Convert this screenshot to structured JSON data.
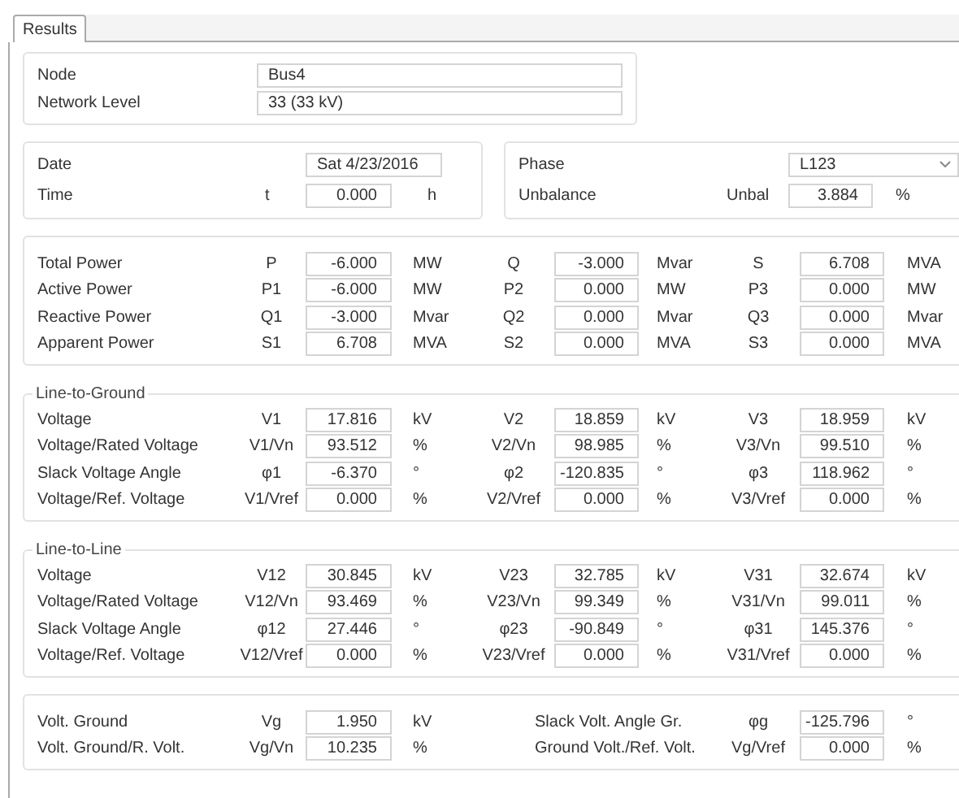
{
  "tabs": [
    {
      "label": "Results",
      "selected": true
    }
  ],
  "node": [
    {
      "label": "Node",
      "value": "Bus4"
    },
    {
      "label": "Network Level",
      "value": "33 (33 kV)"
    }
  ],
  "date_group": {
    "date": {
      "label": "Date",
      "value": "Sat 4/23/2016"
    },
    "time": {
      "label": "Time",
      "symbol": "t",
      "value": "0.000",
      "unit": "h"
    }
  },
  "phase_group": {
    "phase": {
      "label": "Phase",
      "value": "L123"
    },
    "unbalance": {
      "label": "Unbalance",
      "symbol": "Unbal",
      "value": "3.884",
      "unit": "%"
    }
  },
  "sections": [
    {
      "rows": [
        {
          "label": "Total Power",
          "cells": [
            {
              "symbol": "P",
              "value": "-6.000",
              "unit": "MW"
            },
            {
              "symbol": "Q",
              "value": "-3.000",
              "unit": "Mvar"
            },
            {
              "symbol": "S",
              "value": "6.708",
              "unit": "MVA"
            }
          ]
        },
        {
          "label": "Active Power",
          "cells": [
            {
              "symbol": "P1",
              "value": "-6.000",
              "unit": "MW"
            },
            {
              "symbol": "P2",
              "value": "0.000",
              "unit": "MW"
            },
            {
              "symbol": "P3",
              "value": "0.000",
              "unit": "MW"
            }
          ]
        },
        {
          "label": "Reactive Power",
          "cells": [
            {
              "symbol": "Q1",
              "value": "-3.000",
              "unit": "Mvar"
            },
            {
              "symbol": "Q2",
              "value": "0.000",
              "unit": "Mvar"
            },
            {
              "symbol": "Q3",
              "value": "0.000",
              "unit": "Mvar"
            }
          ]
        },
        {
          "label": "Apparent Power",
          "cells": [
            {
              "symbol": "S1",
              "value": "6.708",
              "unit": "MVA"
            },
            {
              "symbol": "S2",
              "value": "0.000",
              "unit": "MVA"
            },
            {
              "symbol": "S3",
              "value": "0.000",
              "unit": "MVA"
            }
          ]
        }
      ]
    },
    {
      "title": "Line-to-Ground",
      "rows": [
        {
          "label": "Voltage",
          "cells": [
            {
              "symbol": "V1",
              "value": "17.816",
              "unit": "kV"
            },
            {
              "symbol": "V2",
              "value": "18.859",
              "unit": "kV"
            },
            {
              "symbol": "V3",
              "value": "18.959",
              "unit": "kV"
            }
          ]
        },
        {
          "label": "Voltage/Rated Voltage",
          "cells": [
            {
              "symbol": "V1/Vn",
              "value": "93.512",
              "unit": "%"
            },
            {
              "symbol": "V2/Vn",
              "value": "98.985",
              "unit": "%"
            },
            {
              "symbol": "V3/Vn",
              "value": "99.510",
              "unit": "%"
            }
          ]
        },
        {
          "label": "Slack Voltage Angle",
          "cells": [
            {
              "symbol": "φ1",
              "value": "-6.370",
              "unit": "°"
            },
            {
              "symbol": "φ2",
              "value": "-120.835",
              "unit": "°"
            },
            {
              "symbol": "φ3",
              "value": "118.962",
              "unit": "°"
            }
          ]
        },
        {
          "label": "Voltage/Ref. Voltage",
          "cells": [
            {
              "symbol": "V1/Vref",
              "value": "0.000",
              "unit": "%"
            },
            {
              "symbol": "V2/Vref",
              "value": "0.000",
              "unit": "%"
            },
            {
              "symbol": "V3/Vref",
              "value": "0.000",
              "unit": "%"
            }
          ]
        }
      ]
    },
    {
      "title": "Line-to-Line",
      "rows": [
        {
          "label": "Voltage",
          "cells": [
            {
              "symbol": "V12",
              "value": "30.845",
              "unit": "kV"
            },
            {
              "symbol": "V23",
              "value": "32.785",
              "unit": "kV"
            },
            {
              "symbol": "V31",
              "value": "32.674",
              "unit": "kV"
            }
          ]
        },
        {
          "label": "Voltage/Rated Voltage",
          "cells": [
            {
              "symbol": "V12/Vn",
              "value": "93.469",
              "unit": "%"
            },
            {
              "symbol": "V23/Vn",
              "value": "99.349",
              "unit": "%"
            },
            {
              "symbol": "V31/Vn",
              "value": "99.011",
              "unit": "%"
            }
          ]
        },
        {
          "label": "Slack Voltage Angle",
          "cells": [
            {
              "symbol": "φ12",
              "value": "27.446",
              "unit": "°"
            },
            {
              "symbol": "φ23",
              "value": "-90.849",
              "unit": "°"
            },
            {
              "symbol": "φ31",
              "value": "145.376",
              "unit": "°"
            }
          ]
        },
        {
          "label": "Voltage/Ref. Voltage",
          "cells": [
            {
              "symbol": "V12/Vref",
              "value": "0.000",
              "unit": "%"
            },
            {
              "symbol": "V23/Vref",
              "value": "0.000",
              "unit": "%"
            },
            {
              "symbol": "V31/Vref",
              "value": "0.000",
              "unit": "%"
            }
          ]
        }
      ]
    }
  ],
  "ground": [
    {
      "items": [
        {
          "label": "Volt. Ground",
          "symbol": "Vg",
          "value": "1.950",
          "unit": "kV"
        },
        {
          "label": "Slack Volt. Angle Gr.",
          "symbol": "φg",
          "value": "-125.796",
          "unit": "°"
        }
      ]
    },
    {
      "items": [
        {
          "label": "Volt. Ground/R. Volt.",
          "symbol": "Vg/Vn",
          "value": "10.235",
          "unit": "%"
        },
        {
          "label": "Ground Volt./Ref. Volt.",
          "symbol": "Vg/Vref",
          "value": "0.000",
          "unit": "%"
        }
      ]
    }
  ]
}
